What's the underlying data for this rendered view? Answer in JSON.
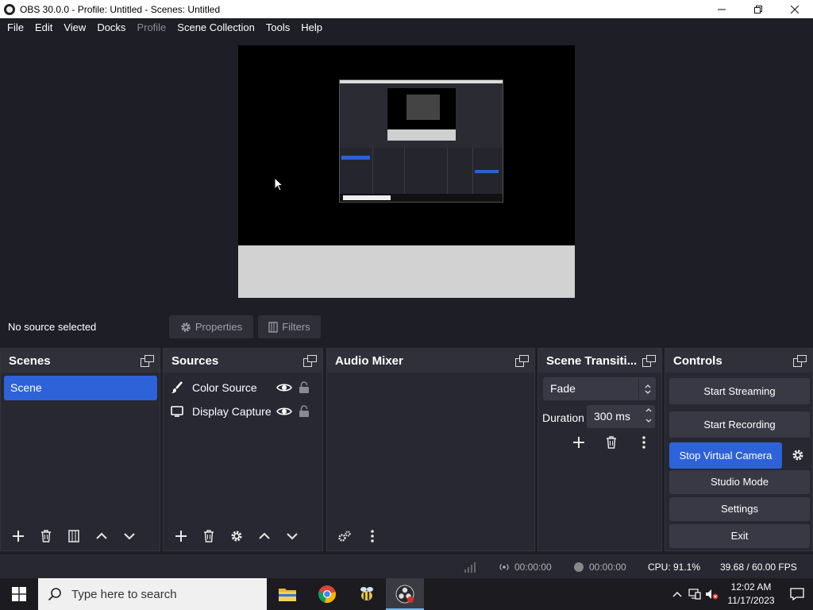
{
  "window": {
    "title": "OBS 30.0.0 - Profile: Untitled - Scenes: Untitled",
    "minimize_label": "—",
    "maximize_label": "❐",
    "close_label": "✕"
  },
  "menu": {
    "items": [
      "File",
      "Edit",
      "View",
      "Docks",
      "Profile",
      "Scene Collection",
      "Tools",
      "Help"
    ]
  },
  "source_strip": {
    "no_source_label": "No source selected",
    "properties_label": "Properties",
    "filters_label": "Filters"
  },
  "scenes": {
    "title": "Scenes",
    "items": [
      "Scene"
    ]
  },
  "sources": {
    "title": "Sources",
    "items": [
      {
        "label": "Color Source",
        "icon": "brush-icon"
      },
      {
        "label": "Display Capture",
        "icon": "monitor-icon"
      }
    ]
  },
  "mixer": {
    "title": "Audio Mixer"
  },
  "transitions": {
    "title": "Scene Transiti...",
    "selected": "Fade",
    "duration_label": "Duration",
    "duration_value": "300 ms"
  },
  "controls": {
    "title": "Controls",
    "start_streaming": "Start Streaming",
    "start_recording": "Start Recording",
    "stop_virtual_camera": "Stop Virtual Camera",
    "studio_mode": "Studio Mode",
    "settings": "Settings",
    "exit": "Exit"
  },
  "stats": {
    "stream_time": "00:00:00",
    "record_time": "00:00:00",
    "cpu": "CPU: 91.1%",
    "fps": "39.68 / 60.00 FPS"
  },
  "taskbar": {
    "search_placeholder": "Type here to search",
    "time": "12:02 AM",
    "date": "11/17/2023"
  },
  "colors": {
    "accent": "#2e62d9",
    "background": "#1e1f26",
    "dock": "#272831"
  }
}
